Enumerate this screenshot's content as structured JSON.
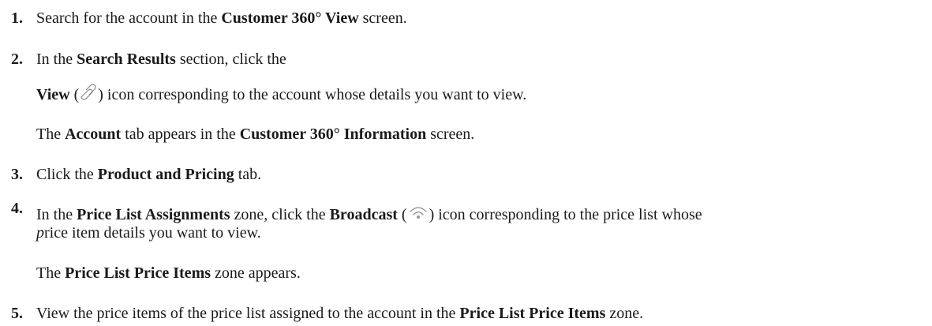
{
  "steps": [
    {
      "num": "1.",
      "parts": [
        "Search for the account in the ",
        "Customer 360° View",
        " screen."
      ]
    },
    {
      "num": "2.",
      "line1": [
        "In the ",
        "Search Results",
        " section, click the"
      ],
      "line2": [
        "View",
        " (",
        ") icon corresponding to the account whose details you want to view."
      ],
      "icon": "link-icon",
      "result": [
        "The ",
        "Account",
        " tab appears in the ",
        "Customer 360° Information",
        " screen."
      ]
    },
    {
      "num": "3.",
      "parts": [
        "Click the ",
        "Product and Pricing",
        " tab."
      ]
    },
    {
      "num": "4.",
      "line1": [
        "In the ",
        "Price List Assignments",
        " zone, click the ",
        "Broadcast",
        " (",
        ") icon corresponding to the price list whose"
      ],
      "line2": [
        "p",
        "rice item details you want to view."
      ],
      "icon": "broadcast-icon",
      "result": [
        "The ",
        "Price List Price Items",
        " zone appears."
      ]
    },
    {
      "num": "5.",
      "parts": [
        "View the price items of the price list assigned to the account in the ",
        "Price List Price Items",
        " zone."
      ]
    }
  ]
}
